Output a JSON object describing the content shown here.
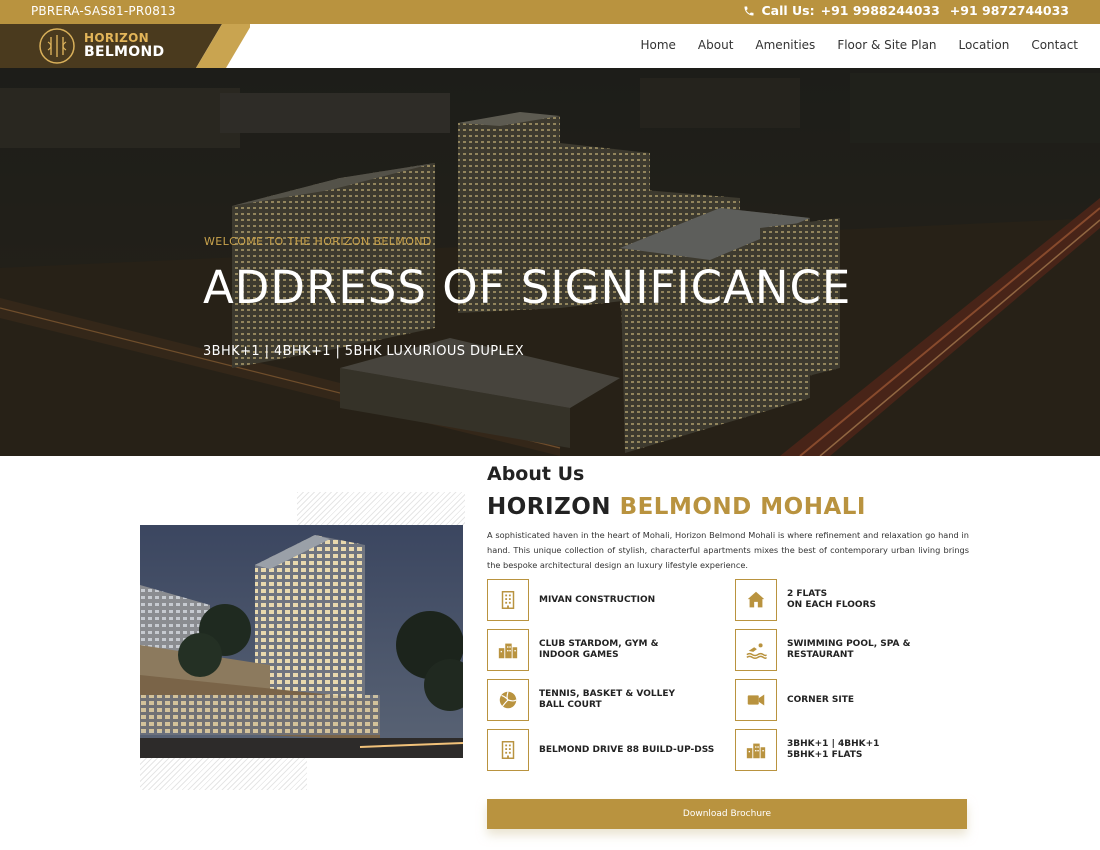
{
  "topbar": {
    "rera": "PBRERA-SAS81-PR0813",
    "call_label": "Call Us:",
    "phone1": "+91 9988244033",
    "phone2": "+91 9872744033"
  },
  "brand": {
    "line1": "HORIZON",
    "line2": "BELMOND"
  },
  "nav": {
    "items": [
      "Home",
      "About",
      "Amenities",
      "Floor & Site Plan",
      "Location",
      "Contact"
    ]
  },
  "hero": {
    "welcome": "WELCOME TO THE HORIZON BELMOND",
    "title": "ADDRESS OF SIGNIFICANCE",
    "subtitle": "3BHK+1 | 4BHK+1 | 5BHK LUXURIOUS DUPLEX"
  },
  "about": {
    "label": "About Us",
    "heading_part1": "HORIZON ",
    "heading_part2": "BELMOND MOHALI",
    "description": "A sophisticated haven in the heart of Mohali, Horizon Belmond Mohali is where refinement and relaxation go hand in hand. This unique collection of stylish, characterful apartments mixes the best of contemporary urban living brings the bespoke architectural design an luxury lifestyle experience.",
    "features": [
      {
        "icon": "building-icon",
        "text": "MIVAN CONSTRUCTION"
      },
      {
        "icon": "home-icon",
        "text": "2 FLATS\nON EACH FLOORS"
      },
      {
        "icon": "city-icon",
        "text": "CLUB STARDOM, GYM &\nINDOOR GAMES"
      },
      {
        "icon": "swimmer-icon",
        "text": "SWIMMING POOL, SPA &\nRESTAURANT"
      },
      {
        "icon": "volleyball-icon",
        "text": "TENNIS, BASKET & VOLLEY\nBALL COURT"
      },
      {
        "icon": "video-camera-icon",
        "text": "CORNER SITE"
      },
      {
        "icon": "building-icon",
        "text": "BELMOND DRIVE 88 BUILD-UP-DSS"
      },
      {
        "icon": "city-icon",
        "text": "3BHK+1 | 4BHK+1\n5BHK+1 FLATS"
      }
    ],
    "download_label": "Download Brochure"
  },
  "colors": {
    "gold": "#b9933f",
    "dark_brown": "#4a3a1e"
  }
}
